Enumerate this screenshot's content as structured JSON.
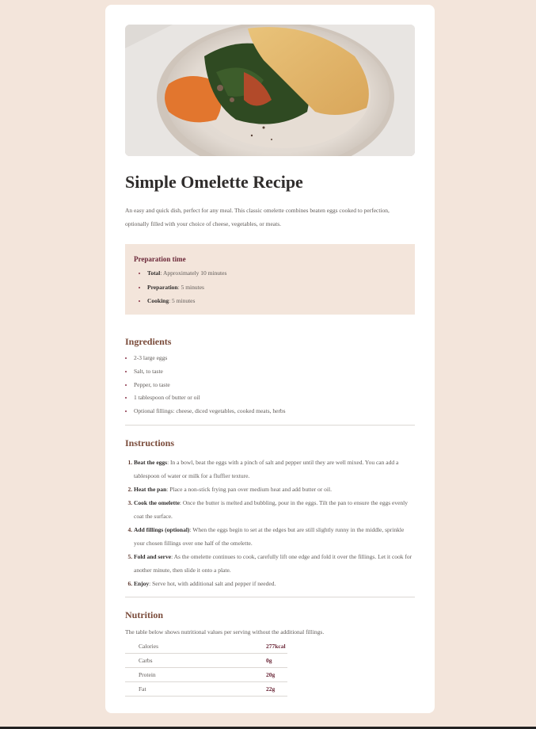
{
  "title": "Simple Omelette Recipe",
  "description": "An easy and quick dish, perfect for any meal. This classic omelette combines beaten eggs cooked to perfection, optionally filled with your choice of cheese, vegetables, or meats.",
  "preparation": {
    "heading": "Preparation time",
    "items": [
      {
        "label": "Total",
        "value": ": Approximately 10 minutes"
      },
      {
        "label": "Preparation",
        "value": ": 5 minutes"
      },
      {
        "label": "Cooking",
        "value": ": 5 minutes"
      }
    ]
  },
  "ingredients": {
    "heading": "Ingredients",
    "items": [
      "2-3 large eggs",
      "Salt, to taste",
      "Pepper, to taste",
      "1 tablespoon of butter or oil",
      "Optional fillings: cheese, diced vegetables, cooked meats, herbs"
    ]
  },
  "instructions": {
    "heading": "Instructions",
    "steps": [
      {
        "label": "Beat the eggs",
        "text": ": In a bowl, beat the eggs with a pinch of salt and pepper until they are well mixed. You can add a tablespoon of water or milk for a fluffier texture."
      },
      {
        "label": "Heat the pan",
        "text": ": Place a non-stick frying pan over medium heat and add butter or oil."
      },
      {
        "label": "Cook the omelette",
        "text": ": Once the butter is melted and bubbling, pour in the eggs. Tilt the pan to ensure the eggs evenly coat the surface."
      },
      {
        "label": "Add fillings (optional)",
        "text": ": When the eggs begin to set at the edges but are still slightly runny in the middle, sprinkle your chosen fillings over one half of the omelette."
      },
      {
        "label": "Fold and serve",
        "text": ": As the omelette continues to cook, carefully lift one edge and fold it over the fillings. Let it cook for another minute, then slide it onto a plate."
      },
      {
        "label": "Enjoy",
        "text": ": Serve hot, with additional salt and pepper if needed."
      }
    ]
  },
  "nutrition": {
    "heading": "Nutrition",
    "intro": "The table below shows nutritional values per serving without the additional fillings.",
    "rows": [
      {
        "name": "Calories",
        "value": "277kcal"
      },
      {
        "name": "Carbs",
        "value": "0g"
      },
      {
        "name": "Protein",
        "value": "20g"
      },
      {
        "name": "Fat",
        "value": "22g"
      }
    ]
  },
  "colors": {
    "page_background": "#f3e5db",
    "card": "#ffffff",
    "accent": "#6b2738",
    "heading_brown": "#7a4b3a"
  }
}
